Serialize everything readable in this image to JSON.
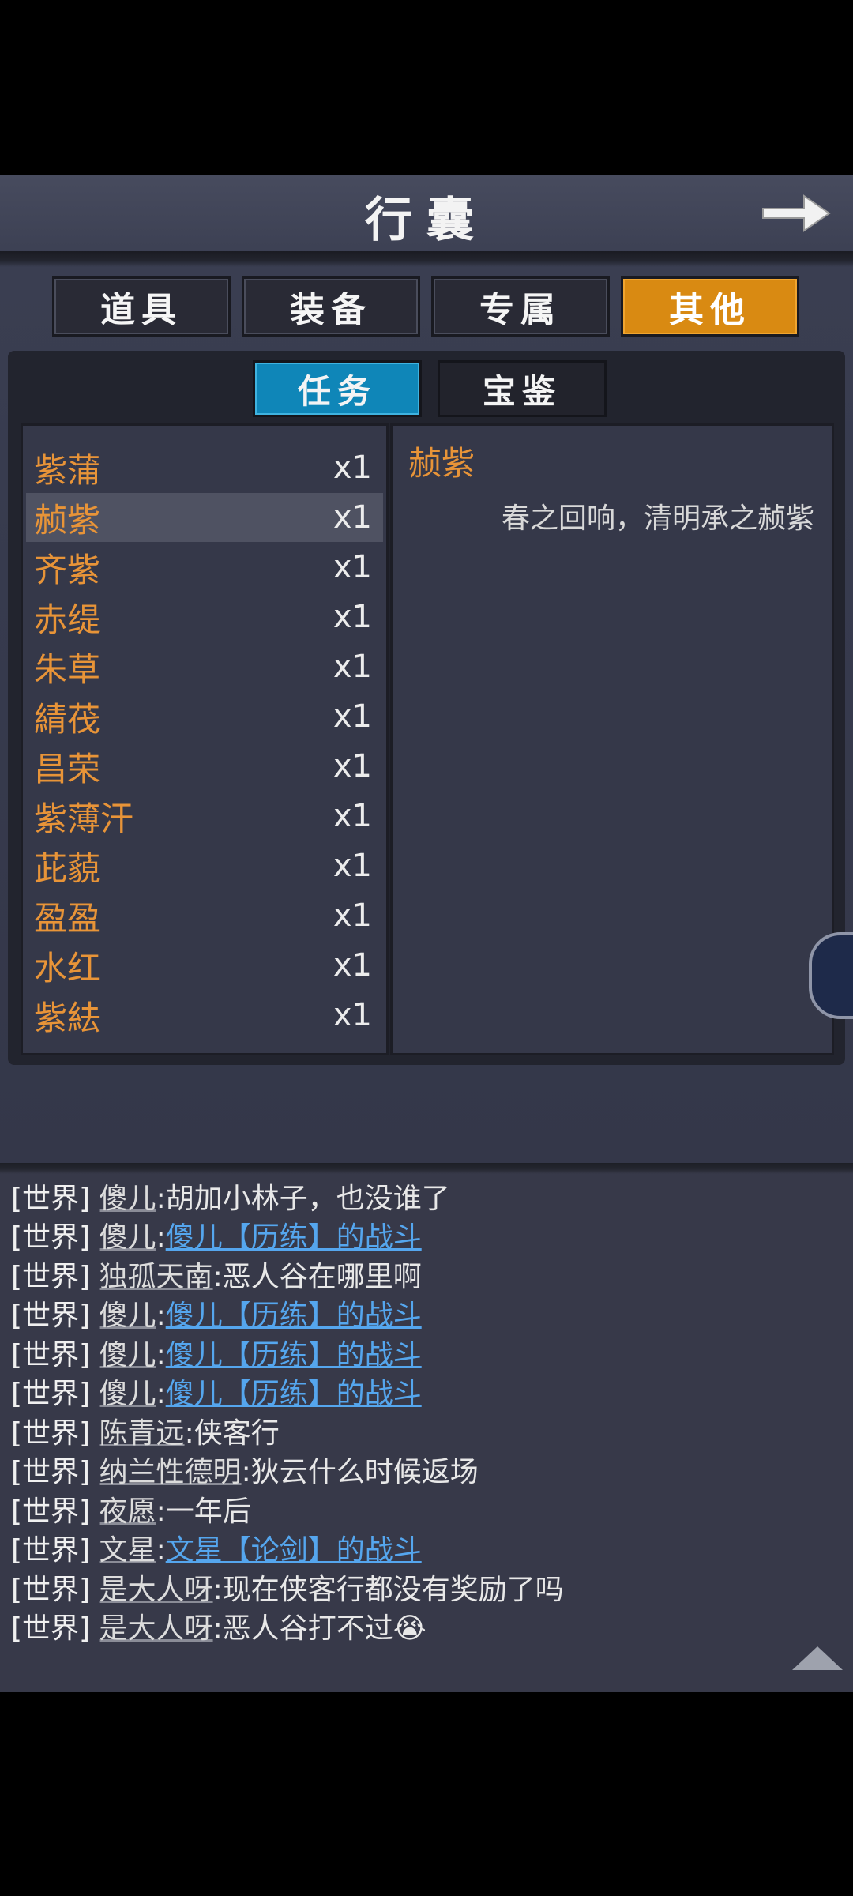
{
  "window": {
    "title": "行囊"
  },
  "tabs": [
    {
      "label": "道具"
    },
    {
      "label": "装备"
    },
    {
      "label": "专属"
    },
    {
      "label": "其他",
      "active": true
    }
  ],
  "subtabs": [
    {
      "label": "任务",
      "active": true
    },
    {
      "label": "宝鉴"
    }
  ],
  "items": [
    {
      "name": "紫蒲",
      "qty": "x1"
    },
    {
      "name": "赪紫",
      "qty": "x1"
    },
    {
      "name": "齐紫",
      "qty": "x1"
    },
    {
      "name": "赤缇",
      "qty": "x1"
    },
    {
      "name": "朱草",
      "qty": "x1"
    },
    {
      "name": "綪茷",
      "qty": "x1"
    },
    {
      "name": "昌荣",
      "qty": "x1"
    },
    {
      "name": "紫薄汗",
      "qty": "x1"
    },
    {
      "name": "茈藐",
      "qty": "x1"
    },
    {
      "name": "盈盈",
      "qty": "x1"
    },
    {
      "name": "水红",
      "qty": "x1"
    },
    {
      "name": "紫紶",
      "qty": "x1"
    }
  ],
  "selected_index": 1,
  "detail": {
    "name": "赪紫",
    "description": "春之回响，清明承之赪紫"
  },
  "chat": [
    {
      "channel": "[世界]",
      "nick": "傻儿",
      "sep": ":",
      "text": "胡加小林子，也没谁了",
      "link": false
    },
    {
      "channel": "[世界]",
      "nick": "傻儿",
      "sep": ":",
      "text": "傻儿【历练】的战斗",
      "link": true
    },
    {
      "channel": "[世界]",
      "nick": "独孤天南",
      "sep": ":",
      "text": "恶人谷在哪里啊",
      "link": false
    },
    {
      "channel": "[世界]",
      "nick": "傻儿",
      "sep": ":",
      "text": "傻儿【历练】的战斗",
      "link": true
    },
    {
      "channel": "[世界]",
      "nick": "傻儿",
      "sep": ":",
      "text": "傻儿【历练】的战斗",
      "link": true
    },
    {
      "channel": "[世界]",
      "nick": "傻儿",
      "sep": ":",
      "text": "傻儿【历练】的战斗",
      "link": true
    },
    {
      "channel": "[世界]",
      "nick": "陈青远",
      "sep": ":",
      "text": "侠客行",
      "link": false
    },
    {
      "channel": "[世界]",
      "nick": "纳兰性德明",
      "sep": ":",
      "text": "狄云什么时候返场",
      "link": false
    },
    {
      "channel": "[世界]",
      "nick": "夜愿",
      "sep": ":",
      "text": "一年后",
      "link": false
    },
    {
      "channel": "[世界]",
      "nick": "文星",
      "sep": ":",
      "text": "文星【论剑】的战斗",
      "link": true
    },
    {
      "channel": "[世界]",
      "nick": "是大人呀",
      "sep": ":",
      "text": "现在侠客行都没有奖励了吗",
      "link": false
    },
    {
      "channel": "[世界]",
      "nick": "是大人呀",
      "sep": ":",
      "text": "恶人谷打不过😭",
      "link": false
    }
  ],
  "colors": {
    "accent_orange": "#d98a12",
    "accent_blue": "#0f86b8",
    "item_name": "#e89438",
    "chat_link": "#55a6ee"
  }
}
